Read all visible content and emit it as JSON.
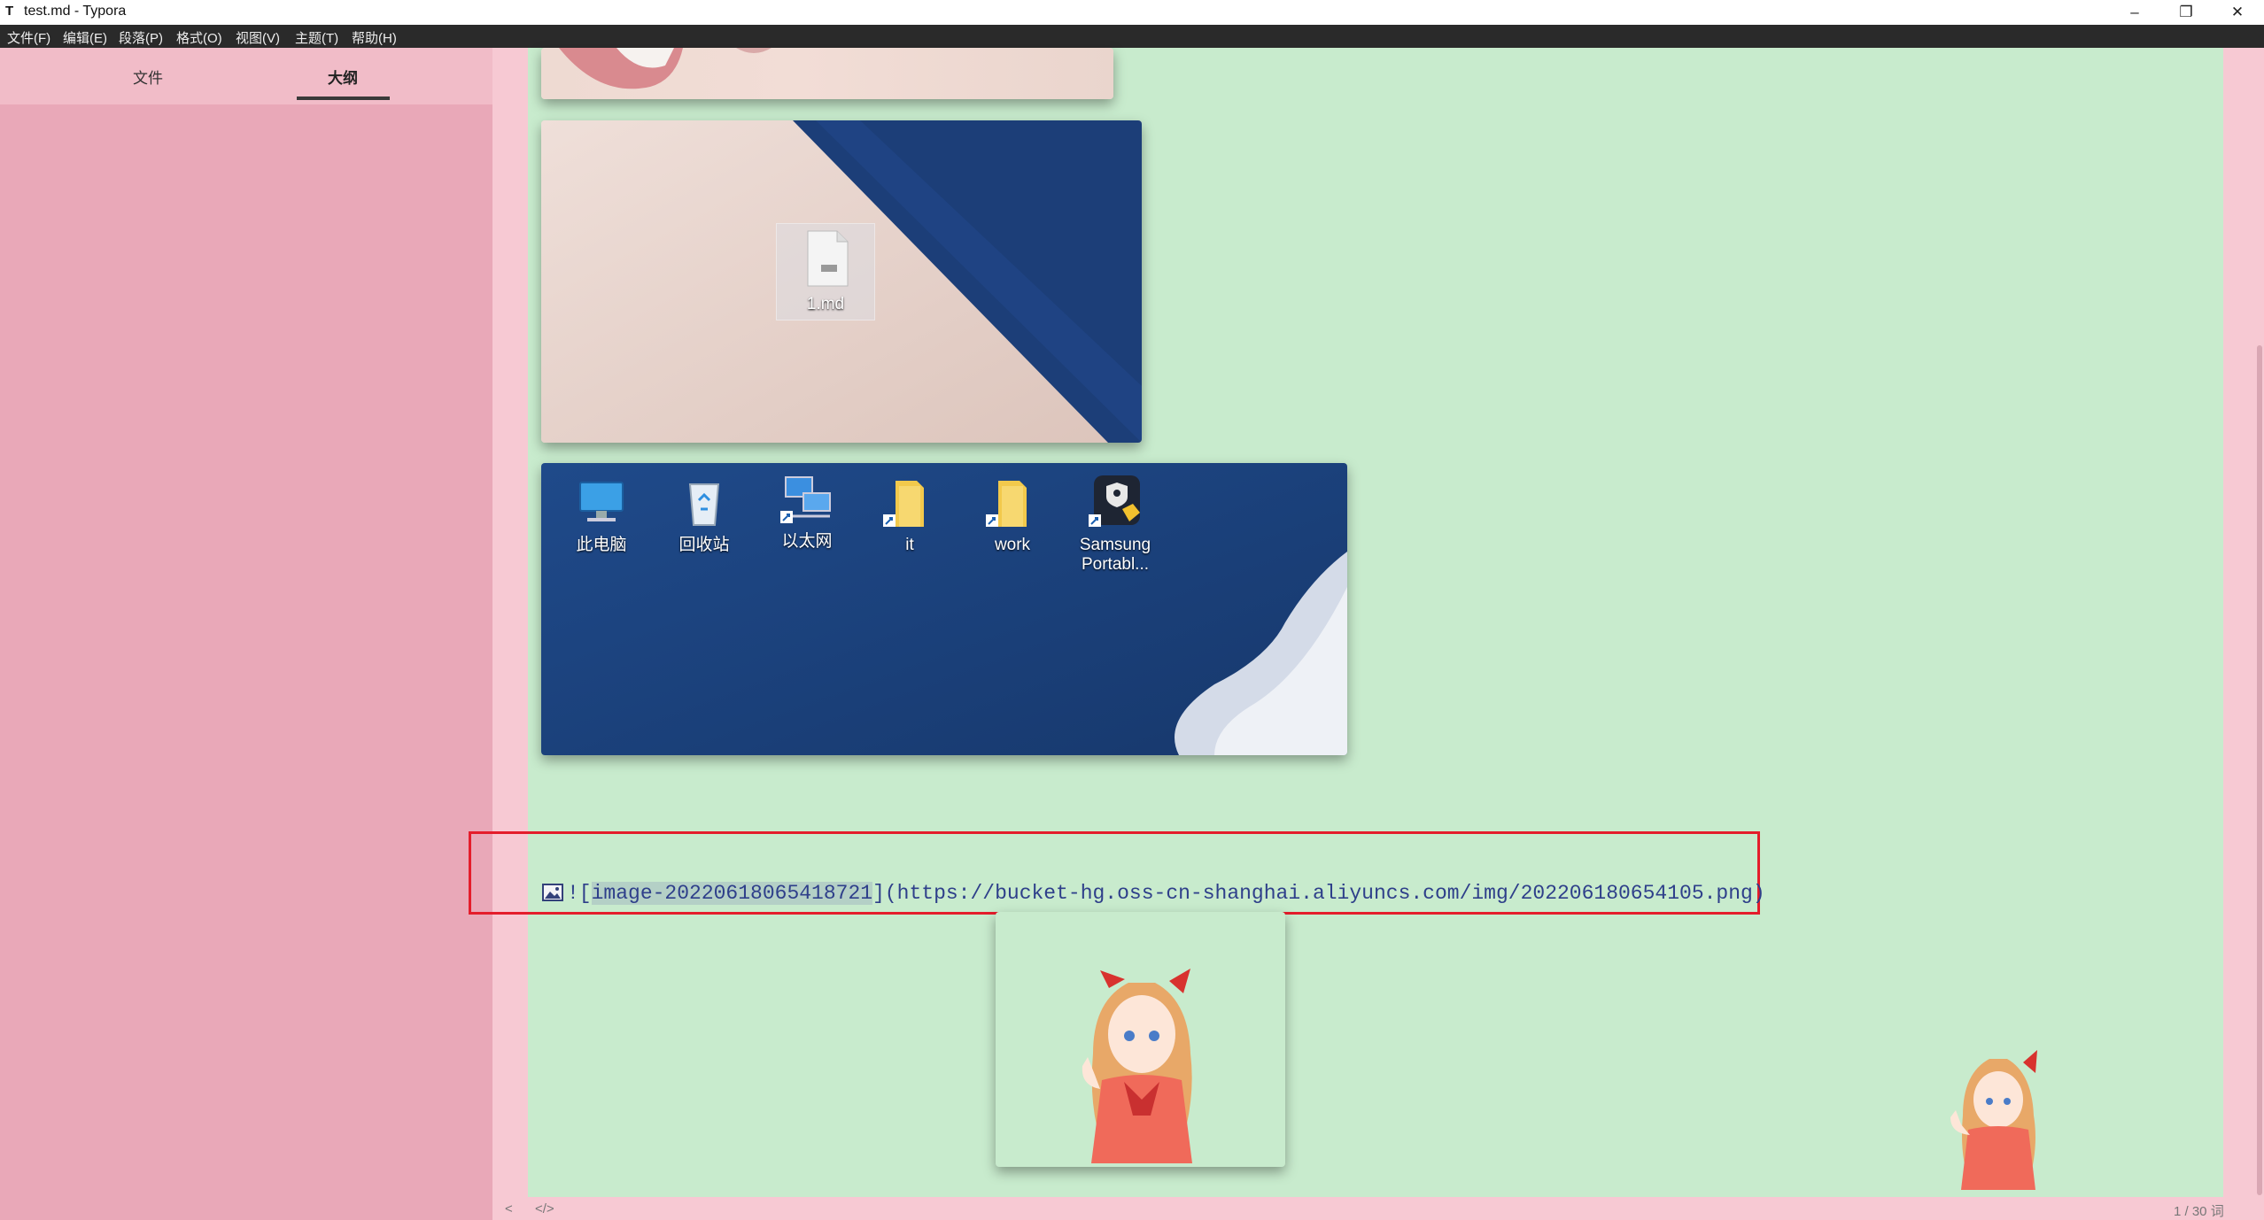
{
  "window": {
    "app_icon": "T",
    "title": "test.md - Typora",
    "minimize_glyph": "–",
    "maximize_glyph": "❐",
    "close_glyph": "✕"
  },
  "menu": [
    "文件(F)",
    "编辑(E)",
    "段落(P)",
    "格式(O)",
    "视图(V)",
    "主题(T)",
    "帮助(H)"
  ],
  "sidebar": {
    "tabs": [
      {
        "label": "文件",
        "active": false
      },
      {
        "label": "大纲",
        "active": true
      }
    ]
  },
  "editor": {
    "file_icon_label": "1.md",
    "desktop_icons": [
      {
        "icon": "computer-icon",
        "label": "此电脑"
      },
      {
        "icon": "recycle-bin-icon",
        "label": "回收站"
      },
      {
        "icon": "network-icon",
        "label": "以太网"
      },
      {
        "icon": "folder-icon",
        "label": "it"
      },
      {
        "icon": "folder-icon",
        "label": "work"
      },
      {
        "icon": "samsung-shield-icon",
        "label": "Samsung Portabl..."
      }
    ],
    "image_markdown": {
      "prefix": "![",
      "alt": "image-20220618065418721",
      "middle": "](",
      "url": "https://bucket-hg.oss-cn-shanghai.aliyuncs.com/img/202206180654105.png",
      "suffix": ")"
    }
  },
  "status": {
    "back_glyph": "<",
    "source_toggle": "</>",
    "word_count": "1 / 30 词"
  },
  "colors": {
    "sidebar_bg": "#e9a8b8",
    "editor_bg": "#c8ebcd",
    "accent_pink": "#f7c9d3",
    "highlight_red": "#e41d2b",
    "link_blue": "#2e3f8a"
  }
}
